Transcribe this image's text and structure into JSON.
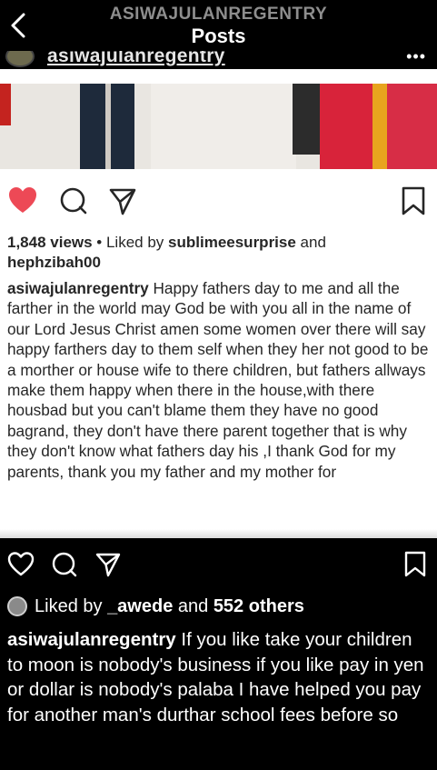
{
  "header": {
    "username": "ASIWAJULANREGENTRY",
    "title": "Posts"
  },
  "embedded_post": {
    "username": "asiwajulanregentry",
    "more": "•••",
    "likes_views": "1,848 views",
    "likes_sep": " • Liked by ",
    "likes_user1": "sublimeesurprise",
    "likes_and": " and ",
    "likes_user2": "hephzibah00",
    "caption_user": "asiwajulanregentry",
    "caption_text": " Happy fathers day to me and all the farther in the world may God be with you all in the name of our Lord Jesus Christ amen some women over there will say happy farthers day to them self when they her not good to be a morther or house wife to there children, but fathers allways make them happy when there in the house,with there housbad but you can't blame them they have no good bagrand, they don't have there parent together that is why they don't know what fathers day his ,I thank God for my parents, thank you my father and my mother for"
  },
  "actions": {
    "like_icon": "heart-icon",
    "comment_icon": "comment-icon",
    "share_icon": "send-icon",
    "save_icon": "bookmark-icon",
    "liked_prefix": "Liked by ",
    "liked_user": "_awede",
    "liked_and": " and ",
    "liked_others": "552 others"
  },
  "caption": {
    "user": "asiwajulanregentry",
    "text": " If you like take your children to moon is nobody's business if you like pay in yen or dollar  is nobody's palaba I have helped you pay for  another man's durthar school fees before so"
  },
  "colors": {
    "background": "#000000",
    "heart_red": "#ed4956",
    "header_subtitle": "#8e8e8e"
  }
}
